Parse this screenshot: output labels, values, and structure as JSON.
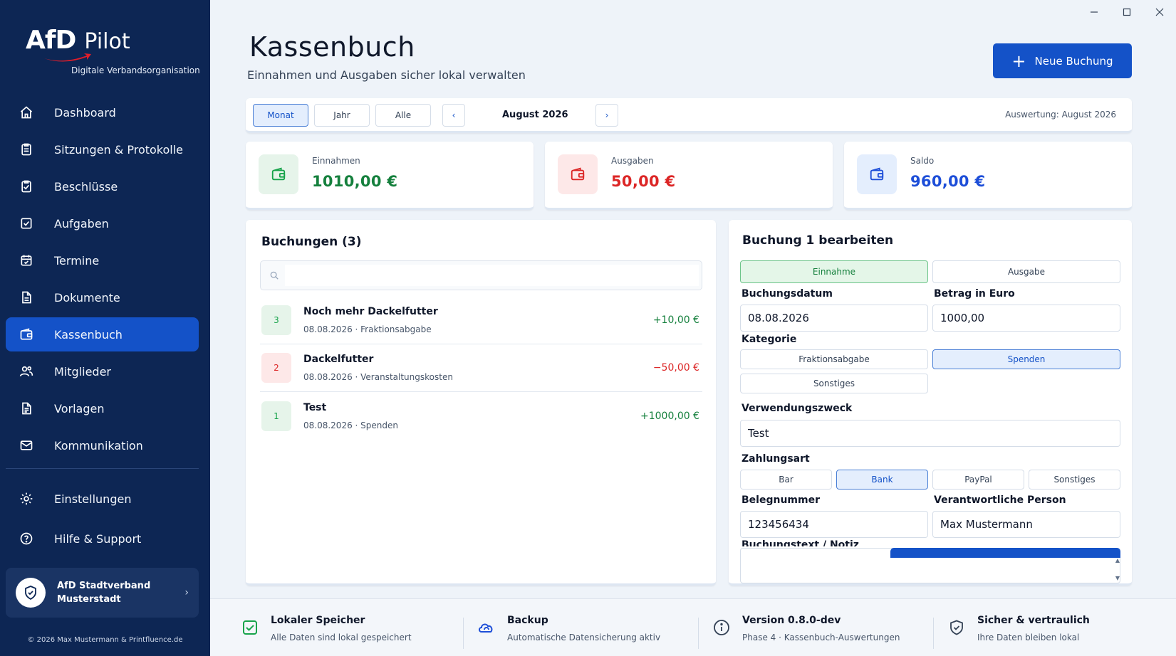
{
  "brand": {
    "afd": "AfD",
    "pilot": "Pilot",
    "subtitle": "Digitale Verbandsorganisation"
  },
  "nav": {
    "items": [
      {
        "label": "Dashboard",
        "icon": "home-icon"
      },
      {
        "label": "Sitzungen & Protokolle",
        "icon": "clipboard-icon"
      },
      {
        "label": "Beschlüsse",
        "icon": "clipboard-check-icon"
      },
      {
        "label": "Aufgaben",
        "icon": "checkbox-icon"
      },
      {
        "label": "Termine",
        "icon": "calendar-icon"
      },
      {
        "label": "Dokumente",
        "icon": "document-icon"
      },
      {
        "label": "Kassenbuch",
        "icon": "wallet-icon",
        "active": true
      },
      {
        "label": "Mitglieder",
        "icon": "users-icon"
      },
      {
        "label": "Vorlagen",
        "icon": "template-icon"
      },
      {
        "label": "Kommunikation",
        "icon": "mail-icon"
      }
    ],
    "secondary": [
      {
        "label": "Einstellungen",
        "icon": "gear-icon"
      },
      {
        "label": "Hilfe & Support",
        "icon": "help-icon"
      }
    ]
  },
  "org": {
    "name": "AfD Stadtverband Musterstadt"
  },
  "copyright": "© 2026 Max Mustermann & Printfluence.de",
  "header": {
    "title": "Kassenbuch",
    "subtitle": "Einnahmen und Ausgaben sicher lokal verwalten",
    "new_button": "Neue Buchung"
  },
  "filter": {
    "modes": [
      "Monat",
      "Jahr",
      "Alle"
    ],
    "active_mode": "Monat",
    "period": "August 2026",
    "evaluation": "Auswertung: August 2026"
  },
  "summary": {
    "income": {
      "label": "Einnahmen",
      "value": "1010,00 €"
    },
    "expenses": {
      "label": "Ausgaben",
      "value": "50,00 €"
    },
    "balance": {
      "label": "Saldo",
      "value": "960,00 €"
    }
  },
  "bookings": {
    "title": "Buchungen (3)",
    "search_placeholder": "",
    "rows": [
      {
        "id": "3",
        "title": "Noch mehr Dackelfutter",
        "meta": "08.08.2026 · Fraktionsabgabe",
        "amount": "+10,00 €",
        "type": "in"
      },
      {
        "id": "2",
        "title": "Dackelfutter",
        "meta": "08.08.2026 · Veranstaltungskosten",
        "amount": "−50,00 €",
        "type": "out"
      },
      {
        "id": "1",
        "title": "Test",
        "meta": "08.08.2026 · Spenden",
        "amount": "+1000,00 €",
        "type": "in"
      }
    ]
  },
  "edit": {
    "title": "Buchung 1 bearbeiten",
    "type_options": [
      "Einnahme",
      "Ausgabe"
    ],
    "type_selected": "Einnahme",
    "date_label": "Buchungsdatum",
    "date_value": "08.08.2026",
    "amount_label": "Betrag in Euro",
    "amount_value": "1000,00",
    "category_label": "Kategorie",
    "categories": [
      "Fraktionsabgabe",
      "Spenden",
      "Sonstiges"
    ],
    "category_selected": "Spenden",
    "purpose_label": "Verwendungszweck",
    "purpose_value": "Test",
    "payment_label": "Zahlungsart",
    "payment_options": [
      "Bar",
      "Bank",
      "PayPal",
      "Sonstiges"
    ],
    "payment_selected": "Bank",
    "receipt_label": "Belegnummer",
    "receipt_value": "123456434",
    "person_label": "Verantwortliche Person",
    "person_value": "Max Mustermann",
    "note_label": "Buchungstext / Notiz"
  },
  "footer": [
    {
      "title": "Lokaler Speicher",
      "sub": "Alle Daten sind lokal gespeichert",
      "icon": "check-square-icon"
    },
    {
      "title": "Backup",
      "sub": "Automatische Datensicherung aktiv",
      "icon": "cloud-sync-icon"
    },
    {
      "title": "Version 0.8.0-dev",
      "sub": "Phase 4 · Kassenbuch-Auswertungen",
      "icon": "info-icon"
    },
    {
      "title": "Sicher & vertraulich",
      "sub": "Ihre Daten bleiben lokal",
      "icon": "shield-icon"
    }
  ],
  "colors": {
    "sidebar": "#0d2654",
    "accent": "#1452c8",
    "income": "#15803d",
    "expense": "#dc2626",
    "balance": "#1d4ed8"
  }
}
